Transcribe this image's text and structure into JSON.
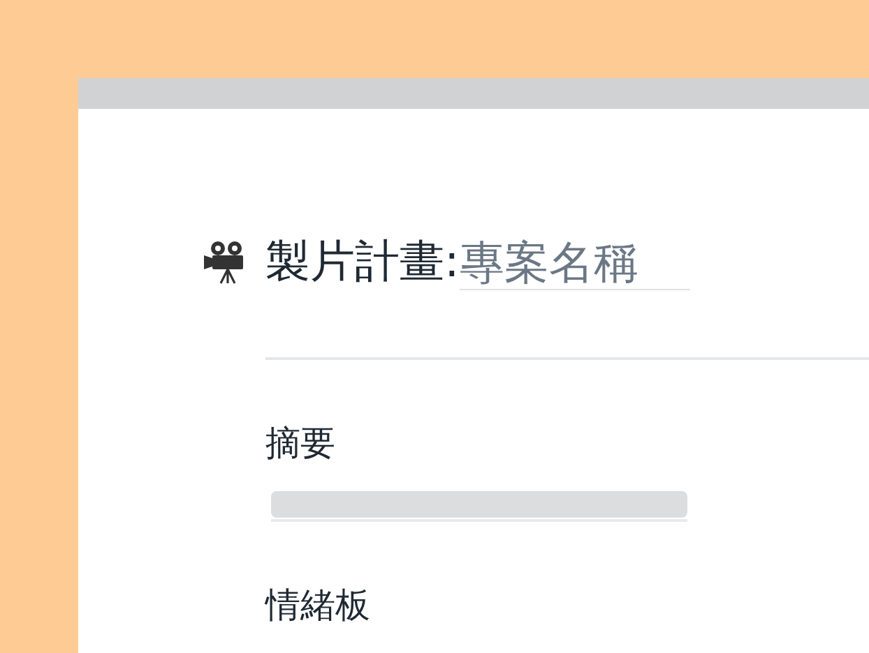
{
  "top_bar": {
    "kind": "bar"
  },
  "header": {
    "title": "製片計畫:",
    "project_name": {
      "placeholder": "專案名稱"
    }
  },
  "sections": [
    {
      "label": "摘要",
      "field": {
        "kind": "loading"
      }
    },
    {
      "label": "情緒板"
    }
  ]
}
